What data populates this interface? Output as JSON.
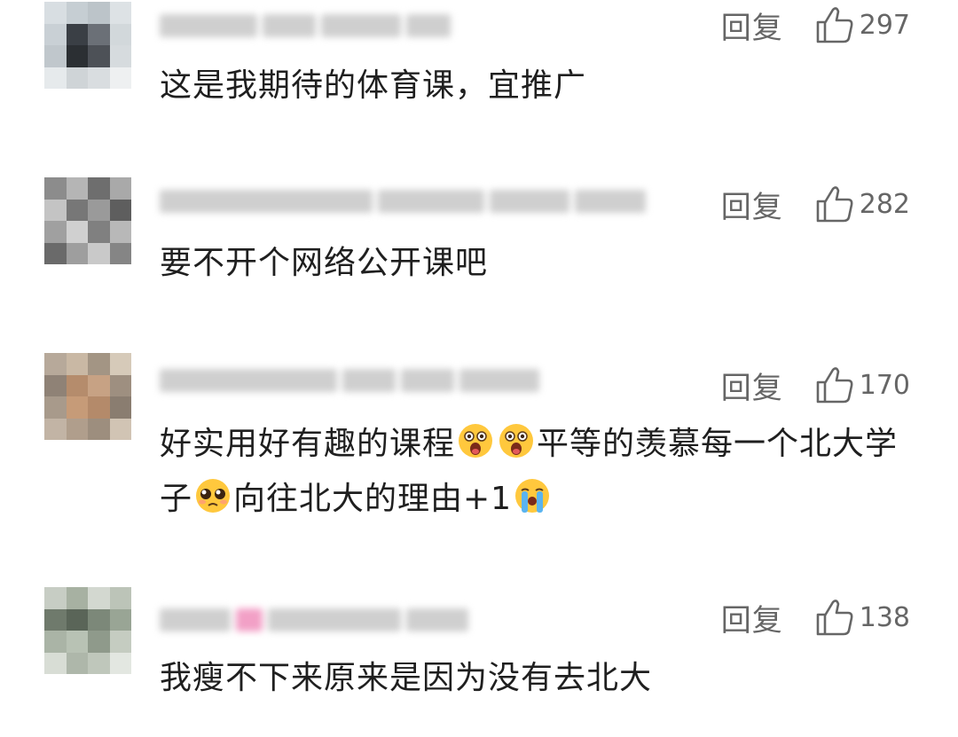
{
  "comments": [
    {
      "reply_label": "回复",
      "likes": "297",
      "text_parts": [
        "这是我期待的体育课，宜推广"
      ]
    },
    {
      "reply_label": "回复",
      "likes": "282",
      "text_parts": [
        "要不开个网络公开课吧"
      ]
    },
    {
      "reply_label": "回复",
      "likes": "170",
      "text_parts": [
        "好实用好有趣的课程",
        "平等的羡慕每一个北大学子",
        "向往北大的理由+1"
      ]
    },
    {
      "reply_label": "回复",
      "likes": "138",
      "text_parts": [
        "我瘦不下来原来是因为没有去北大"
      ]
    }
  ],
  "icons": {
    "like": "thumbs-up-outline-icon",
    "emoji_shocked": "shocked-face-emoji-icon",
    "emoji_pleading": "pleading-face-emoji-icon",
    "emoji_crying": "loudly-crying-face-emoji-icon"
  },
  "colors": {
    "text": "#1f1f1f",
    "secondary": "#666666",
    "emoji": "#ffc83d"
  }
}
